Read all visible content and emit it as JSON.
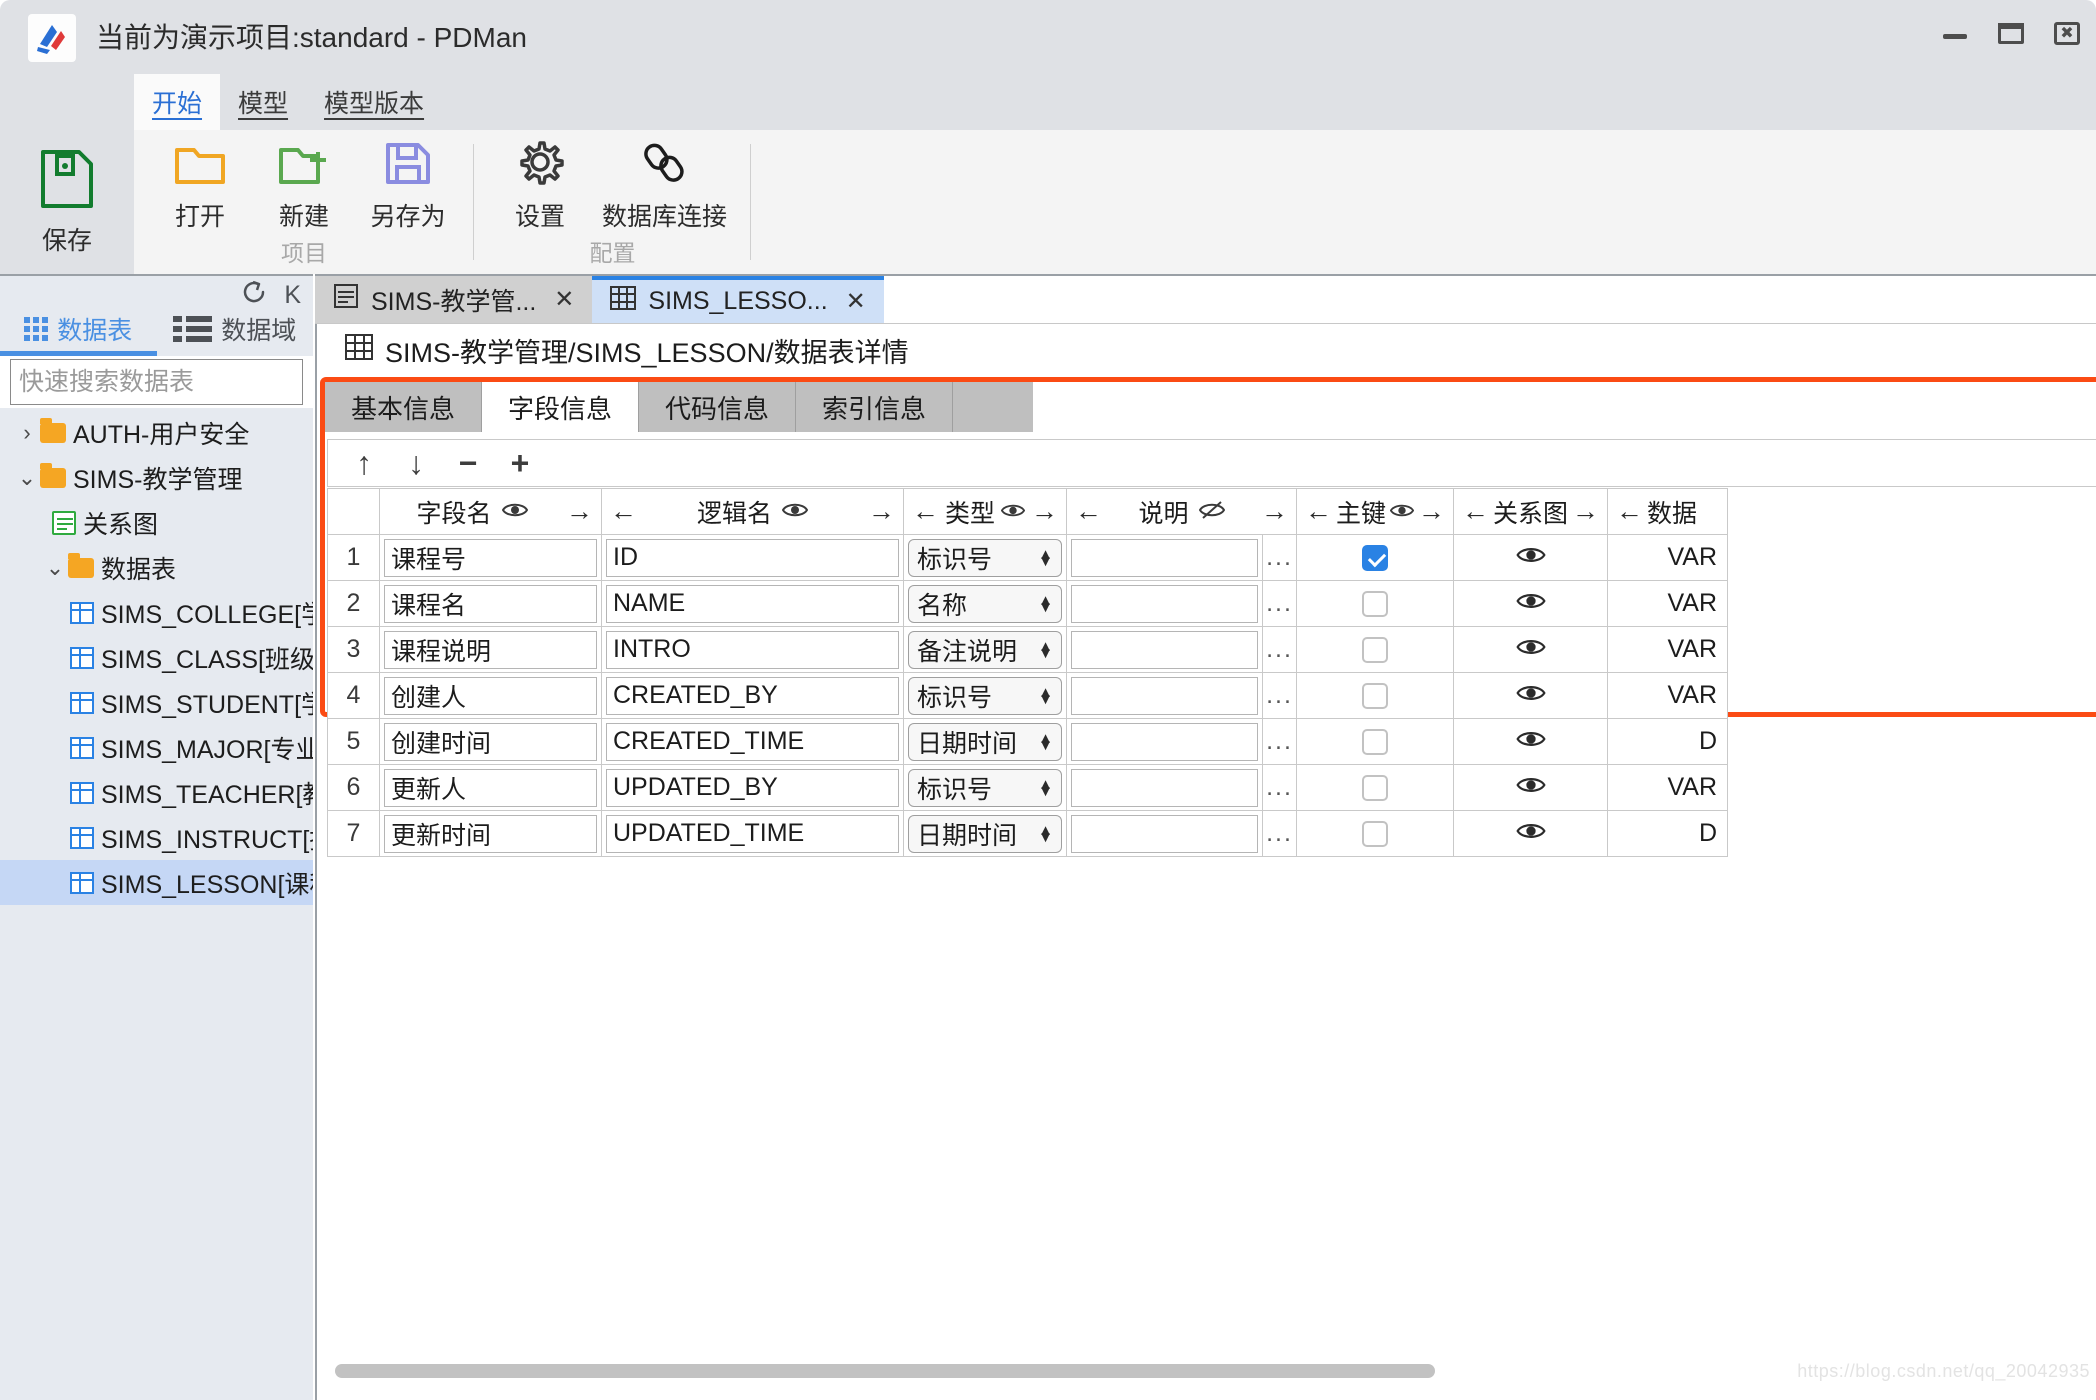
{
  "window": {
    "title": "当前为演示项目:standard - PDMan",
    "logo_icon": "pdman-logo-icon",
    "minimize_icon": "minimize-icon",
    "maximize_icon": "maximize-icon",
    "close_icon": "close-icon",
    "exit_icon": "exit-logout-icon"
  },
  "ribbon": {
    "tabs": [
      {
        "label": "开始",
        "active": true
      },
      {
        "label": "模型",
        "active": false
      },
      {
        "label": "模型版本",
        "active": false
      }
    ],
    "save": {
      "label": "保存",
      "icon": "save-disk-icon"
    },
    "groups": [
      {
        "title": "项目",
        "items": [
          {
            "label": "打开",
            "icon": "open-folder-icon"
          },
          {
            "label": "新建",
            "icon": "new-folder-icon"
          },
          {
            "label": "另存为",
            "icon": "save-as-icon"
          }
        ]
      },
      {
        "title": "配置",
        "items": [
          {
            "label": "设置",
            "icon": "gear-icon"
          },
          {
            "label": "数据库连接",
            "icon": "link-chain-icon"
          }
        ]
      }
    ]
  },
  "sidebar": {
    "refresh_icon": "refresh-icon",
    "k_icon": "K",
    "tabs": [
      {
        "label": "数据表",
        "icon": "grid-icon",
        "active": true
      },
      {
        "label": "数据域",
        "icon": "list-icon",
        "active": false
      }
    ],
    "search": {
      "placeholder": "快速搜索数据表",
      "value": ""
    },
    "tree": [
      {
        "label": "AUTH-用户安全",
        "type": "folder",
        "indent": 0,
        "chev": "›",
        "selected": false
      },
      {
        "label": "SIMS-教学管理",
        "type": "folder",
        "indent": 0,
        "chev": "⌄",
        "selected": false
      },
      {
        "label": "关系图",
        "type": "diagram",
        "indent": 1,
        "chev": "",
        "selected": false
      },
      {
        "label": "数据表",
        "type": "folder",
        "indent": 1,
        "chev": "⌄",
        "selected": false
      },
      {
        "label": "SIMS_COLLEGE[学院]",
        "type": "table",
        "indent": 2,
        "chev": "",
        "selected": false
      },
      {
        "label": "SIMS_CLASS[班级]",
        "type": "table",
        "indent": 2,
        "chev": "",
        "selected": false
      },
      {
        "label": "SIMS_STUDENT[学生]",
        "type": "table",
        "indent": 2,
        "chev": "",
        "selected": false
      },
      {
        "label": "SIMS_MAJOR[专业]",
        "type": "table",
        "indent": 2,
        "chev": "",
        "selected": false
      },
      {
        "label": "SIMS_TEACHER[教师]",
        "type": "table",
        "indent": 2,
        "chev": "",
        "selected": false
      },
      {
        "label": "SIMS_INSTRUCT[授课]",
        "type": "table",
        "indent": 2,
        "chev": "",
        "selected": false
      },
      {
        "label": "SIMS_LESSON[课程]",
        "type": "table",
        "indent": 2,
        "chev": "",
        "selected": true
      }
    ]
  },
  "main": {
    "doc_tabs": [
      {
        "label": "SIMS-教学管...",
        "icon": "diagram-icon",
        "close": "✕",
        "active": false
      },
      {
        "label": "SIMS_LESSO...",
        "icon": "table-icon",
        "close": "✕",
        "active": true
      }
    ],
    "breadcrumb": {
      "icon": "table-icon",
      "text": "SIMS-教学管理/SIMS_LESSON/数据表详情"
    },
    "panel_tabs": [
      {
        "label": "基本信息",
        "active": false
      },
      {
        "label": "字段信息",
        "active": true
      },
      {
        "label": "代码信息",
        "active": false
      },
      {
        "label": "索引信息",
        "active": false
      }
    ],
    "grid_toolbar": [
      {
        "icon": "arrow-up-icon",
        "glyph": "↑"
      },
      {
        "icon": "arrow-down-icon",
        "glyph": "↓"
      },
      {
        "icon": "minus-icon",
        "glyph": "−"
      },
      {
        "icon": "plus-icon",
        "glyph": "+"
      }
    ],
    "grid": {
      "columns": [
        {
          "label": "",
          "key": "num",
          "left_arrow": false,
          "right_arrow": false,
          "eye": "none"
        },
        {
          "label": "字段名",
          "key": "field_name",
          "left_arrow": false,
          "right_arrow": true,
          "eye": "visible"
        },
        {
          "label": "逻辑名",
          "key": "logic_name",
          "left_arrow": true,
          "right_arrow": true,
          "eye": "visible"
        },
        {
          "label": "类型",
          "key": "type",
          "left_arrow": true,
          "right_arrow": true,
          "eye": "visible"
        },
        {
          "label": "说明",
          "key": "remark",
          "left_arrow": true,
          "right_arrow": true,
          "eye": "hidden"
        },
        {
          "label": "主键",
          "key": "primary_key",
          "left_arrow": true,
          "right_arrow": true,
          "eye": "visible"
        },
        {
          "label": "关系图",
          "key": "relation",
          "left_arrow": true,
          "right_arrow": true,
          "eye": "none"
        },
        {
          "label": "数据",
          "key": "datatype",
          "left_arrow": true,
          "right_arrow": false,
          "eye": "none"
        }
      ],
      "rows": [
        {
          "num": "1",
          "field_name": "课程号",
          "logic_name": "ID",
          "type": "标识号",
          "remark": "",
          "dots": "...",
          "primary_key": true,
          "relation_icon": "eye-icon",
          "datatype": "VAR"
        },
        {
          "num": "2",
          "field_name": "课程名",
          "logic_name": "NAME",
          "type": "名称",
          "remark": "",
          "dots": "...",
          "primary_key": false,
          "relation_icon": "eye-icon",
          "datatype": "VAR"
        },
        {
          "num": "3",
          "field_name": "课程说明",
          "logic_name": "INTRO",
          "type": "备注说明",
          "remark": "",
          "dots": "...",
          "primary_key": false,
          "relation_icon": "eye-icon",
          "datatype": "VAR"
        },
        {
          "num": "4",
          "field_name": "创建人",
          "logic_name": "CREATED_BY",
          "type": "标识号",
          "remark": "",
          "dots": "...",
          "primary_key": false,
          "relation_icon": "eye-icon",
          "datatype": "VAR"
        },
        {
          "num": "5",
          "field_name": "创建时间",
          "logic_name": "CREATED_TIME",
          "type": "日期时间",
          "remark": "",
          "dots": "...",
          "primary_key": false,
          "relation_icon": "eye-icon",
          "datatype": "D"
        },
        {
          "num": "6",
          "field_name": "更新人",
          "logic_name": "UPDATED_BY",
          "type": "标识号",
          "remark": "",
          "dots": "...",
          "primary_key": false,
          "relation_icon": "eye-icon",
          "datatype": "VAR"
        },
        {
          "num": "7",
          "field_name": "更新时间",
          "logic_name": "UPDATED_TIME",
          "type": "日期时间",
          "remark": "",
          "dots": "...",
          "primary_key": false,
          "relation_icon": "eye-icon",
          "datatype": "D"
        }
      ]
    },
    "watermark": "https://blog.csdn.net/qq_20042935"
  },
  "colors": {
    "accent": "#2a82e4",
    "highlight_box": "#fb4b14",
    "chrome": "#dfe1e5",
    "sidebar": "#e6eaf0",
    "selection": "#c5d7f5"
  }
}
